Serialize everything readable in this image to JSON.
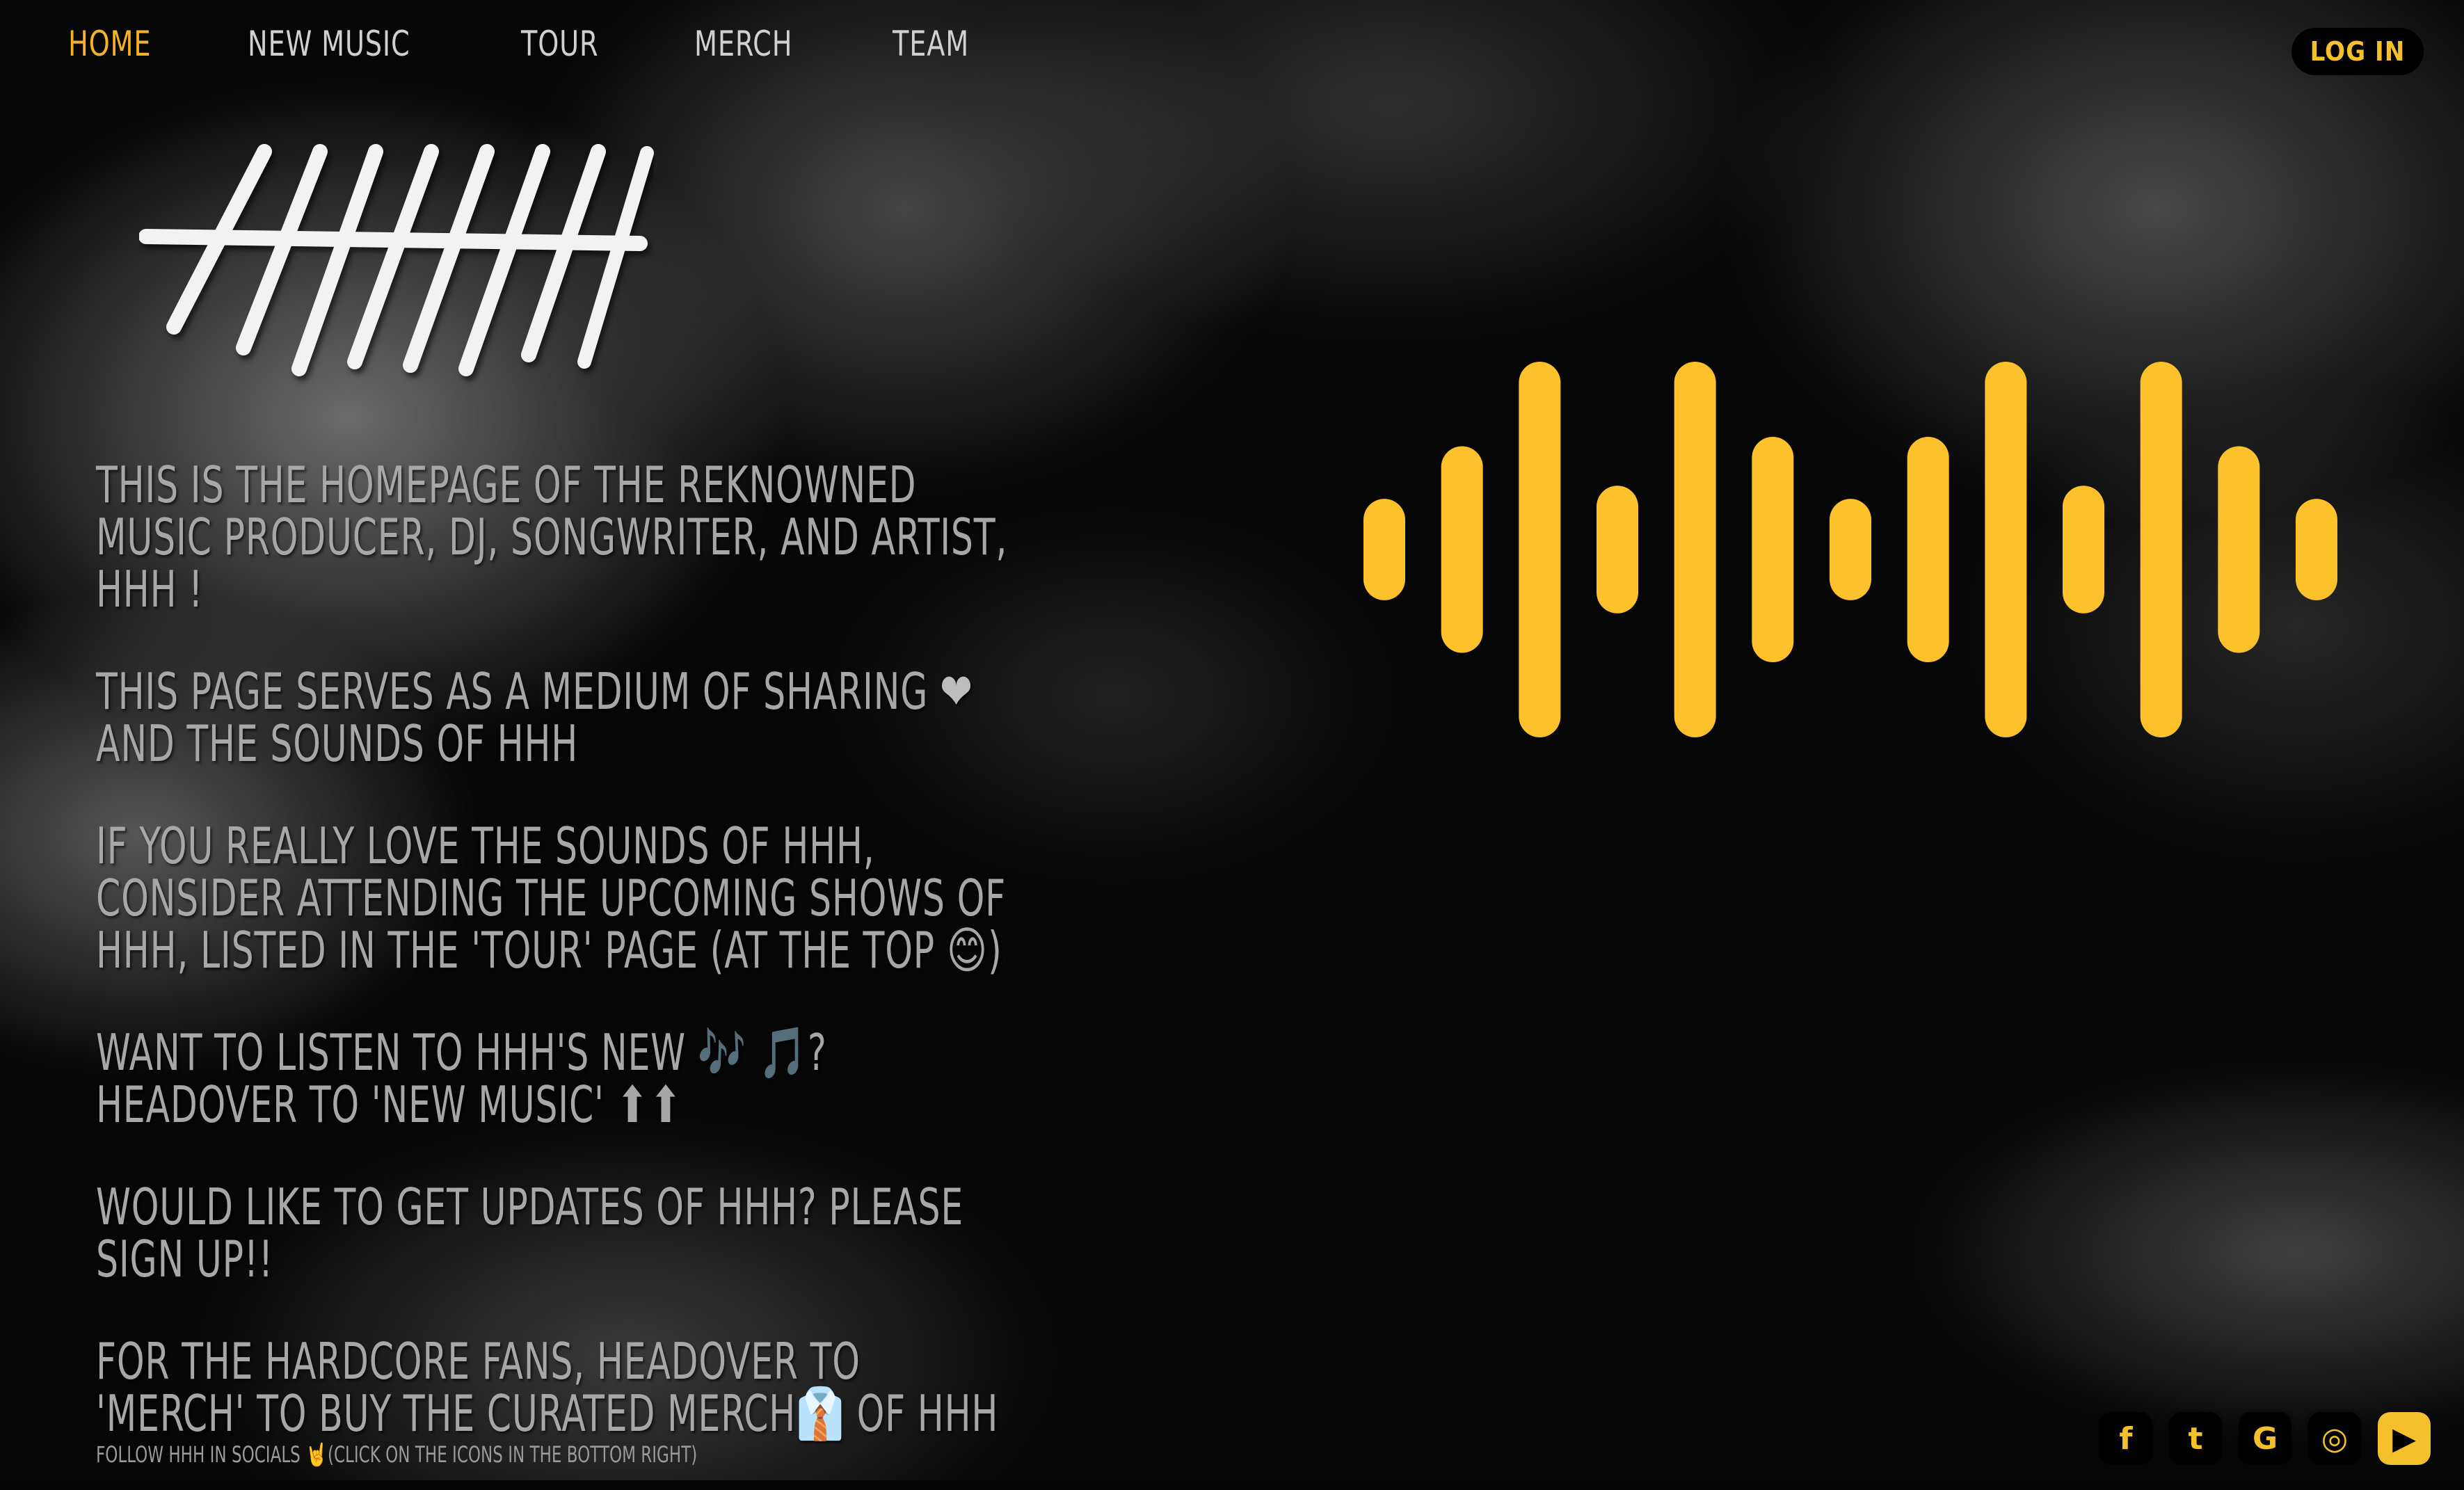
{
  "nav": {
    "items": [
      {
        "label": "HOME",
        "active": true
      },
      {
        "label": "NEW MUSIC",
        "active": false
      },
      {
        "label": "TOUR",
        "active": false
      },
      {
        "label": "MERCH",
        "active": false
      },
      {
        "label": "TEAM",
        "active": false
      }
    ],
    "login_label": "LOG IN"
  },
  "intro": {
    "p1": "THIS IS THE HOMEPAGE OF THE REKNOWNED MUSIC PRODUCER, DJ, SONGWRITER, AND ARTIST, HHH !",
    "p2_a": "THIS PAGE SERVES AS A MEDIUM OF SHARING",
    "p2_b": "AND THE SOUNDS OF HHH",
    "p3_a": "IF YOU REALLY LOVE THE SOUNDS OF HHH, CONSIDER ATTENDING THE UPCOMING SHOWS OF HHH, LISTED IN THE 'TOUR' PAGE (AT THE TOP",
    "p3_b": ")",
    "p4_a": "WANT TO LISTEN TO HHH'S NEW",
    "p4_b": "? HEADOVER TO 'NEW MUSIC'",
    "p5": "WOULD LIKE TO GET UPDATES OF HHH? PLEASE SIGN UP!!",
    "p6_a": "FOR THE HARDCORE FANS, HEADOVER TO 'MERCH' TO BUY THE CURATED MERCH",
    "p6_b": "OF HHH"
  },
  "follow": {
    "a": "FOLLOW HHH IN SOCIALS",
    "b": "(CLICK ON THE ICONS IN THE BOTTOM RIGHT)"
  },
  "emoji": {
    "heart": "❤",
    "smile": "😊",
    "notes": "🎶",
    "note": "🎵",
    "arrows": "⬆⬆",
    "shirt": "👔",
    "horns": "🤘"
  },
  "socials": [
    {
      "icon": "facebook-icon",
      "glyph": "f"
    },
    {
      "icon": "twitter-icon",
      "glyph": "t"
    },
    {
      "icon": "google-icon",
      "glyph": "G"
    },
    {
      "icon": "instagram-icon",
      "glyph": "◎"
    },
    {
      "icon": "youtube-icon",
      "glyph": "▶"
    }
  ],
  "colors": {
    "accent": "#f4b324",
    "wave": "#fcc12b",
    "text": "#a7a7a7"
  },
  "wave_levels": [
    0.27,
    0.55,
    1.0,
    0.34,
    1.0,
    0.6,
    0.27,
    0.6,
    1.0,
    0.34,
    1.0,
    0.55,
    0.27
  ]
}
